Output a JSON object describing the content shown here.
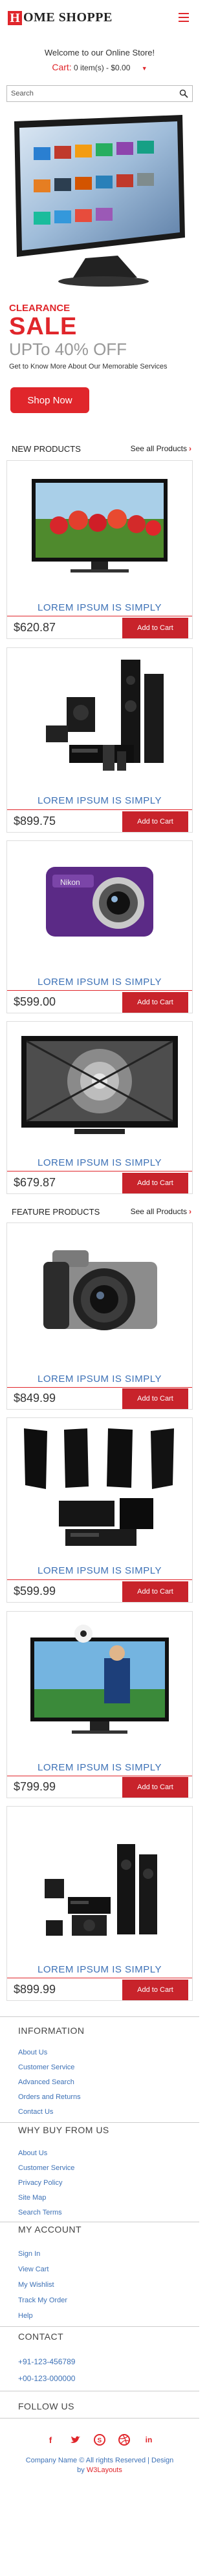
{
  "header": {
    "logo_h": "H",
    "logo_rest": "OME SHOPPE",
    "welcome": "Welcome to our Online Store!",
    "cart_label": "Cart:",
    "cart_summary": "0 item(s) - $0.00"
  },
  "search": {
    "placeholder": "Search"
  },
  "hero": {
    "clearance": "CLEARANCE",
    "sale": "SALE",
    "upto": "UPTo 40% OFF",
    "description": "Get to Know More About Our Memorable Services",
    "button": "Shop Now"
  },
  "new_products": {
    "title": "NEW PRODUCTS",
    "see_all": "See all Products",
    "items": [
      {
        "name": "LOREM IPSUM IS SIMPLY",
        "price": "$620.87",
        "button": "Add to Cart",
        "image": "tv-flowers"
      },
      {
        "name": "LOREM IPSUM IS SIMPLY",
        "price": "$899.75",
        "button": "Add to Cart",
        "image": "home-theater"
      },
      {
        "name": "LOREM IPSUM IS SIMPLY",
        "price": "$599.00",
        "button": "Add to Cart",
        "image": "purple-camera"
      },
      {
        "name": "LOREM IPSUM IS SIMPLY",
        "price": "$679.87",
        "button": "Add to Cart",
        "image": "tv-architecture"
      }
    ]
  },
  "feature_products": {
    "title": "FEATURE PRODUCTS",
    "see_all": "See all Products",
    "items": [
      {
        "name": "LOREM IPSUM IS SIMPLY",
        "price": "$849.99",
        "button": "Add to Cart",
        "image": "dslr-camera"
      },
      {
        "name": "LOREM IPSUM IS SIMPLY",
        "price": "$599.99",
        "button": "Add to Cart",
        "image": "speaker-set"
      },
      {
        "name": "LOREM IPSUM IS SIMPLY",
        "price": "$799.99",
        "button": "Add to Cart",
        "image": "tv-football"
      },
      {
        "name": "LOREM IPSUM IS SIMPLY",
        "price": "$899.99",
        "button": "Add to Cart",
        "image": "home-theater-2"
      }
    ]
  },
  "footer": {
    "information": {
      "title": "INFORMATION",
      "links": [
        "About Us",
        "Customer Service",
        "Advanced Search",
        "Orders and Returns",
        "Contact Us"
      ]
    },
    "why_buy": {
      "title": "WHY BUY FROM US",
      "links": [
        "About Us",
        "Customer Service",
        "Privacy Policy",
        "Site Map",
        "Search Terms"
      ]
    },
    "account": {
      "title": "MY ACCOUNT",
      "links": [
        "Sign In",
        "View Cart",
        "My Wishlist",
        "Track My Order",
        "Help"
      ]
    },
    "contact": {
      "title": "CONTACT",
      "phones": [
        "+91-123-456789",
        "+00-123-000000"
      ]
    },
    "follow": {
      "title": "FOLLOW US",
      "icons": [
        "facebook-icon",
        "twitter-icon",
        "skype-icon",
        "dribbble-icon",
        "linkedin-icon"
      ]
    },
    "copyright_1": "Company Name © All rights Reserved | Design",
    "copyright_by": "by ",
    "copyright_link": "W3Layouts"
  },
  "colors": {
    "accent": "#e0262b",
    "link": "#3d71b6",
    "button": "#c8232b"
  }
}
